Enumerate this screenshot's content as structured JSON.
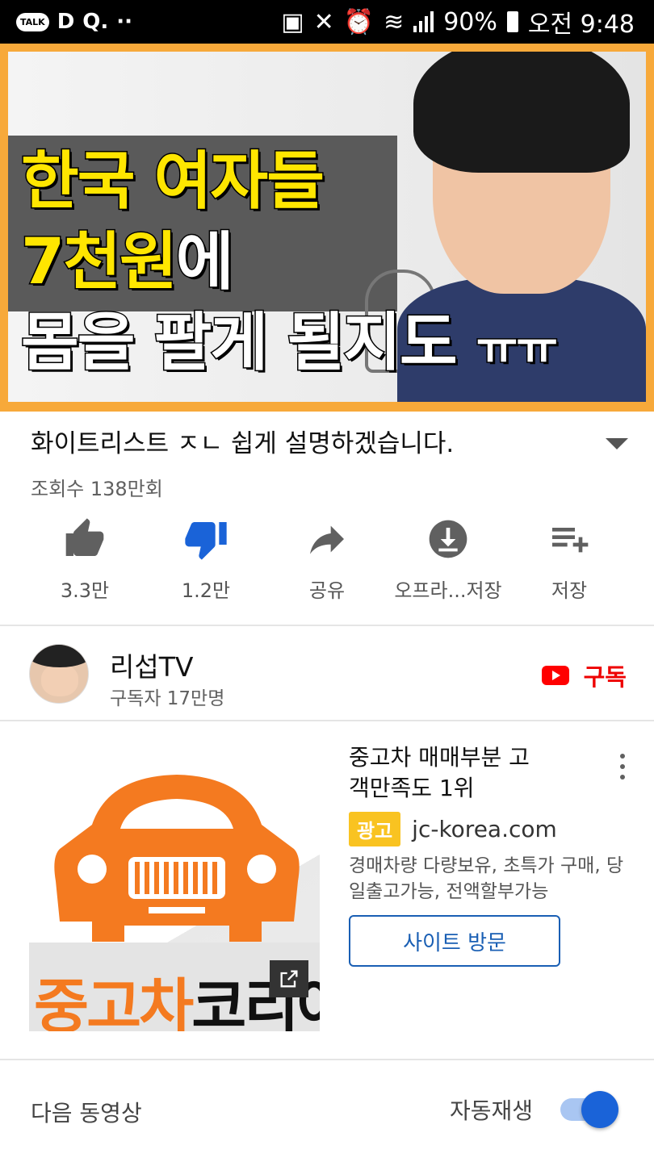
{
  "status_bar": {
    "talk_label": "TALK",
    "left_glyphs": [
      "D",
      "Q.",
      "··"
    ],
    "battery": "90%",
    "time": "오전 9:48"
  },
  "thumbnail": {
    "line1": "한국 여자들",
    "line2_yellow": "7천원",
    "line2_white": "에",
    "line3": "몸을 팔게 될지도",
    "line3_small": "ㅠㅠ"
  },
  "video": {
    "title": "화이트리스트 ㅈㄴ 쉽게 설명하겠습니다.",
    "views": "조회수 138만회"
  },
  "actions": [
    {
      "label": "3.3만",
      "icon": "thumbs-up-icon"
    },
    {
      "label": "1.2만",
      "icon": "thumbs-down-icon"
    },
    {
      "label": "공유",
      "icon": "share-icon"
    },
    {
      "label": "오프라...저장",
      "icon": "download-icon"
    },
    {
      "label": "저장",
      "icon": "playlist-add-icon"
    }
  ],
  "channel": {
    "name": "리섭TV",
    "subscribers": "구독자 17만명",
    "subscribe_label": "구독"
  },
  "ad": {
    "title": "중고차 매매부분 고객만족도 1위",
    "badge": "광고",
    "url": "jc-korea.com",
    "description": "경매차량 다량보유, 초특가 구매, 당일출고가능, 전액할부가능",
    "button": "사이트 방문",
    "logo_orange": "중고차",
    "logo_black": "코리아"
  },
  "next_section": {
    "label": "다음 동영상",
    "autoplay_label": "자동재생",
    "autoplay_on": true
  },
  "colors": {
    "accent_blue": "#1a63d8",
    "subscribe_red": "#e00000",
    "thumb_frame": "#f7a93a",
    "ad_badge": "#f9c321",
    "logo_orange": "#f47a20"
  }
}
